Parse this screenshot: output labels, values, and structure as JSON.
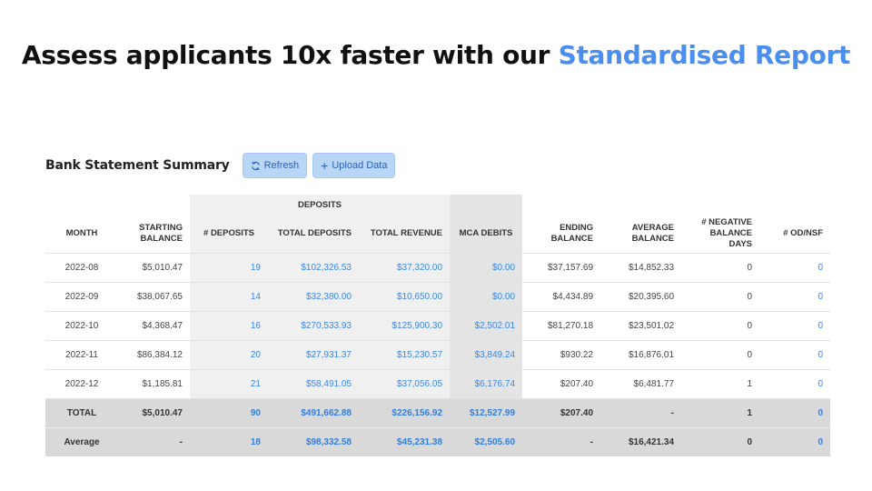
{
  "headline": {
    "text_before": "Assess applicants 10x faster with our ",
    "accent": "Standardised Report"
  },
  "summary": {
    "title": "Bank Statement Summary",
    "refresh_label": "Refresh",
    "upload_label": "Upload Data"
  },
  "table": {
    "group_header": "DEPOSITS",
    "columns": {
      "month": "MONTH",
      "starting_balance": "STARTING BALANCE",
      "num_deposits": "# DEPOSITS",
      "total_deposits": "TOTAL DEPOSITS",
      "total_revenue": "TOTAL REVENUE",
      "mca_debits": "MCA DEBITS",
      "ending_balance": "ENDING BALANCE",
      "average_balance": "AVERAGE BALANCE",
      "neg_balance_days": "# NEGATIVE BALANCE DAYS",
      "od_nsf": "# OD/NSF"
    },
    "rows": [
      {
        "month": "2022-08",
        "starting_balance": "$5,010.47",
        "num_deposits": "19",
        "total_deposits": "$102,326.53",
        "total_revenue": "$37,320.00",
        "mca_debits": "$0.00",
        "ending_balance": "$37,157.69",
        "average_balance": "$14,852.33",
        "neg_balance_days": "0",
        "od_nsf": "0"
      },
      {
        "month": "2022-09",
        "starting_balance": "$38,067.65",
        "num_deposits": "14",
        "total_deposits": "$32,380.00",
        "total_revenue": "$10,650.00",
        "mca_debits": "$0.00",
        "ending_balance": "$4,434.89",
        "average_balance": "$20,395.60",
        "neg_balance_days": "0",
        "od_nsf": "0"
      },
      {
        "month": "2022-10",
        "starting_balance": "$4,368.47",
        "num_deposits": "16",
        "total_deposits": "$270,533.93",
        "total_revenue": "$125,900.30",
        "mca_debits": "$2,502.01",
        "ending_balance": "$81,270.18",
        "average_balance": "$23,501.02",
        "neg_balance_days": "0",
        "od_nsf": "0"
      },
      {
        "month": "2022-11",
        "starting_balance": "$86,384.12",
        "num_deposits": "20",
        "total_deposits": "$27,931.37",
        "total_revenue": "$15,230.57",
        "mca_debits": "$3,849.24",
        "ending_balance": "$930.22",
        "average_balance": "$16,876.01",
        "neg_balance_days": "0",
        "od_nsf": "0"
      },
      {
        "month": "2022-12",
        "starting_balance": "$1,185.81",
        "num_deposits": "21",
        "total_deposits": "$58,491.05",
        "total_revenue": "$37,056.05",
        "mca_debits": "$6,176.74",
        "ending_balance": "$207.40",
        "average_balance": "$6,481.77",
        "neg_balance_days": "1",
        "od_nsf": "0"
      }
    ],
    "total": {
      "month": "TOTAL",
      "starting_balance": "$5,010.47",
      "num_deposits": "90",
      "total_deposits": "$491,662.88",
      "total_revenue": "$226,156.92",
      "mca_debits": "$12,527.99",
      "ending_balance": "$207.40",
      "average_balance": "-",
      "neg_balance_days": "1",
      "od_nsf": "0"
    },
    "average": {
      "month": "Average",
      "starting_balance": "-",
      "num_deposits": "18",
      "total_deposits": "$98,332.58",
      "total_revenue": "$45,231.38",
      "mca_debits": "$2,505.60",
      "ending_balance": "-",
      "average_balance": "$16,421.34",
      "neg_balance_days": "0",
      "od_nsf": "0"
    }
  },
  "colors": {
    "accent": "#4a8ef0",
    "link": "#3b86e0",
    "button_bg": "#b9d6f7"
  },
  "icons": {
    "refresh": "refresh-icon",
    "upload": "plus-icon"
  }
}
